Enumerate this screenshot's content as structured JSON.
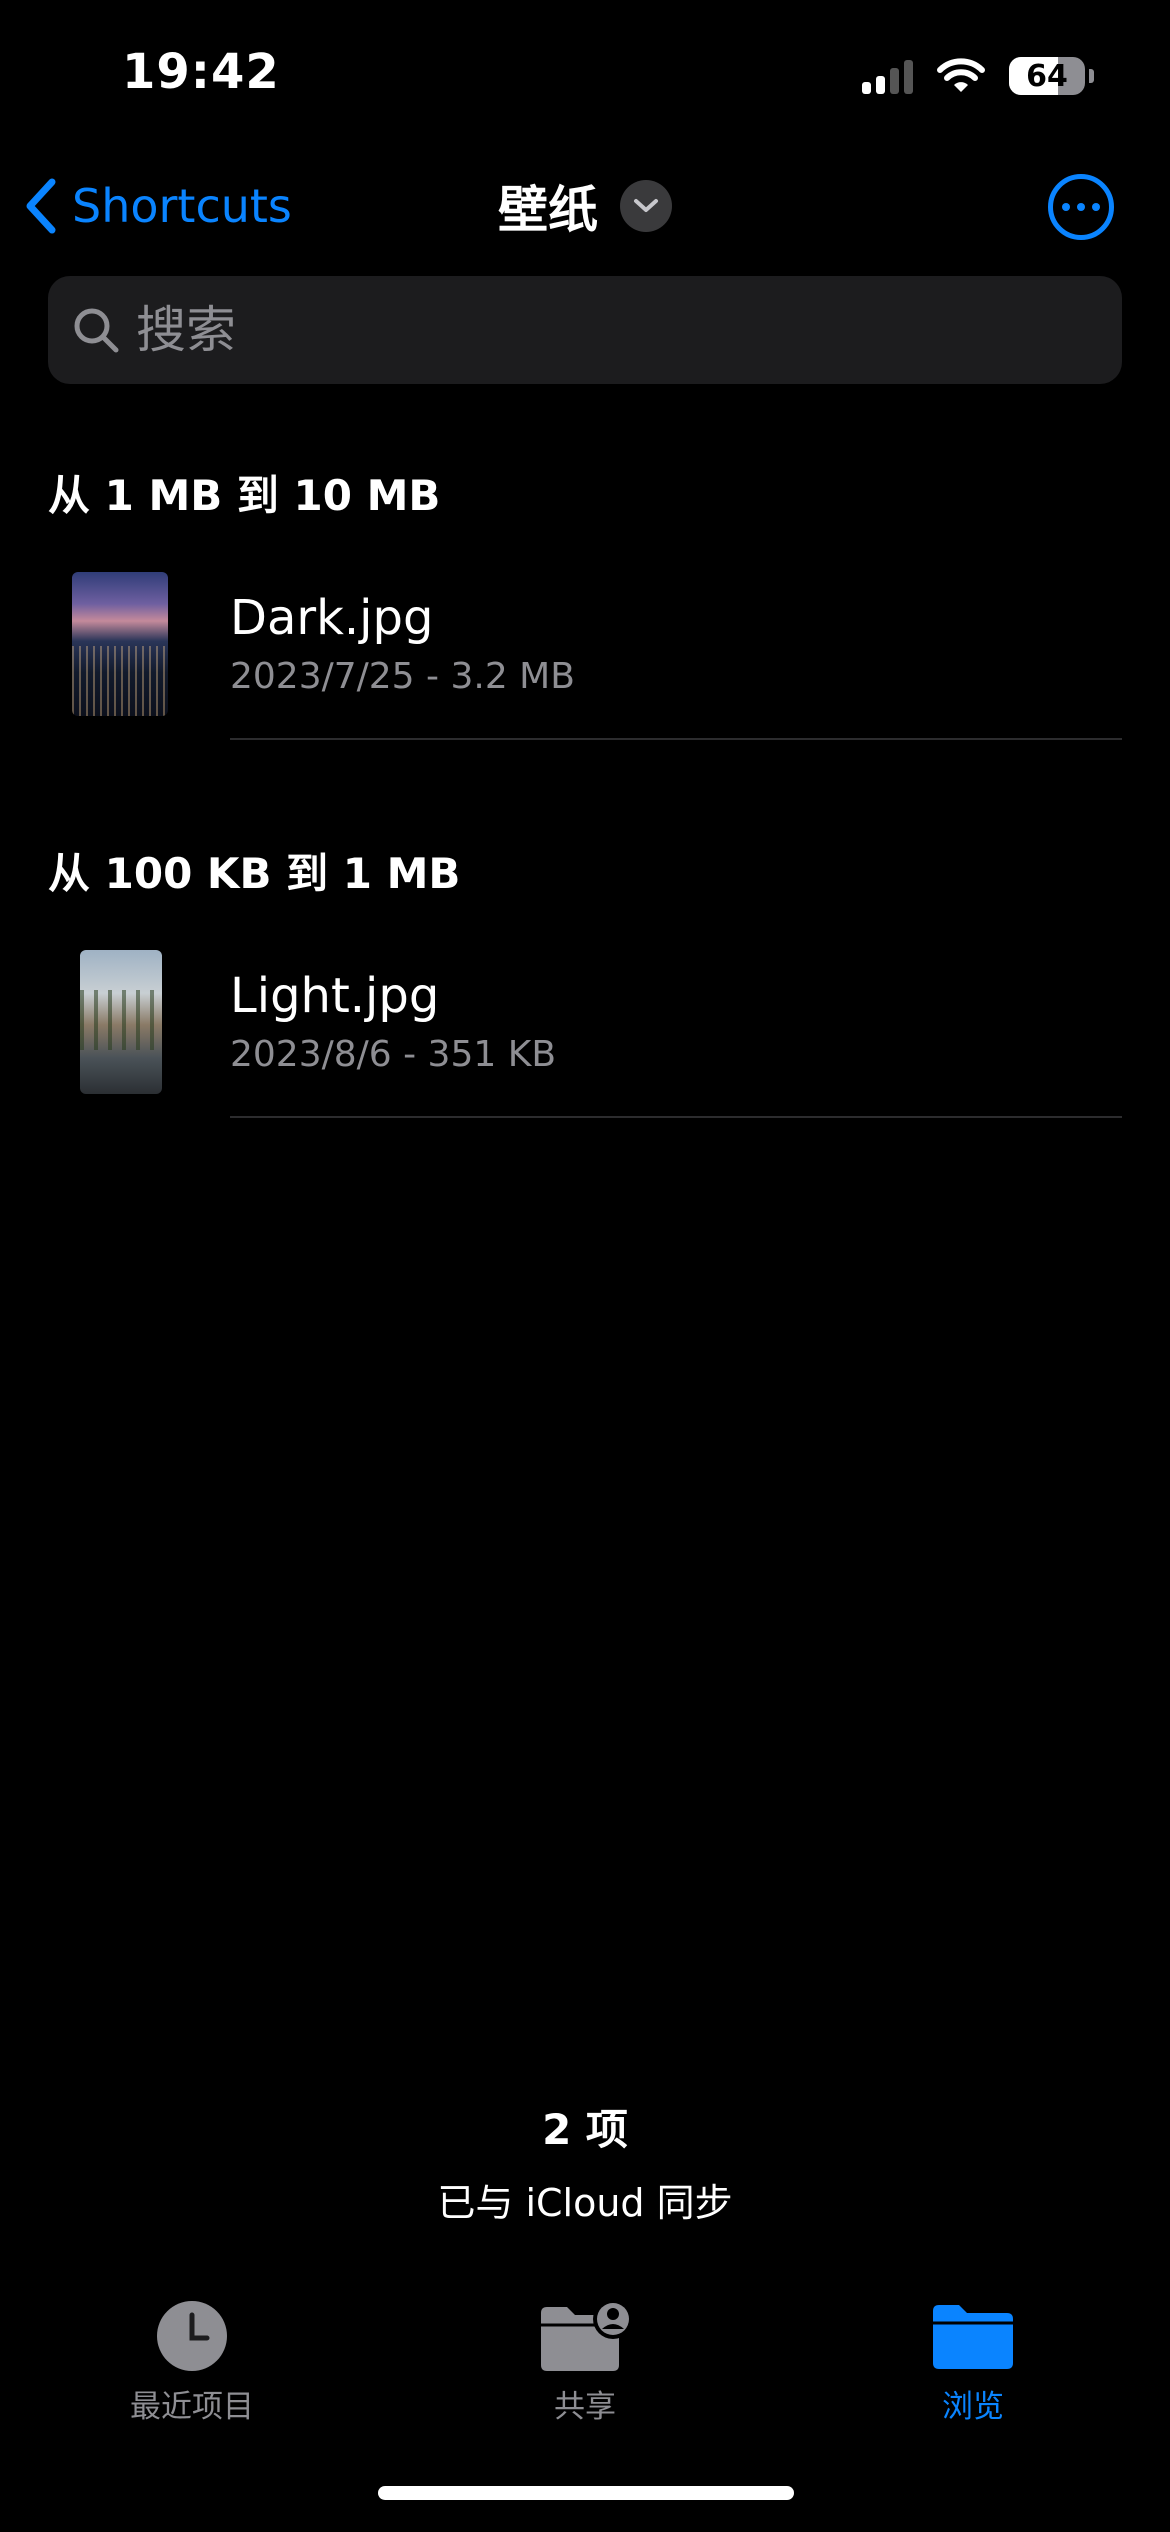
{
  "status_bar": {
    "time": "19:42",
    "battery": "64",
    "battery_level": 0.64
  },
  "nav": {
    "back_label": "Shortcuts",
    "title": "壁纸"
  },
  "search": {
    "placeholder": "搜索"
  },
  "sections": [
    {
      "header": "从 1 MB 到 10 MB",
      "files": [
        {
          "name": "Dark.jpg",
          "meta": "2023/7/25 - 3.2 MB"
        }
      ]
    },
    {
      "header": "从 100 KB 到 1 MB",
      "files": [
        {
          "name": "Light.jpg",
          "meta": "2023/8/6 - 351 KB"
        }
      ]
    }
  ],
  "footer": {
    "count": "2 项",
    "sync_status": "已与 iCloud 同步"
  },
  "tab_bar": {
    "recents_label": "最近项目",
    "shared_label": "共享",
    "browse_label": "浏览",
    "active_tab": "browse"
  },
  "colors": {
    "accent": "#0a84ff",
    "background": "#000000",
    "secondary_text": "#8e8e93"
  }
}
